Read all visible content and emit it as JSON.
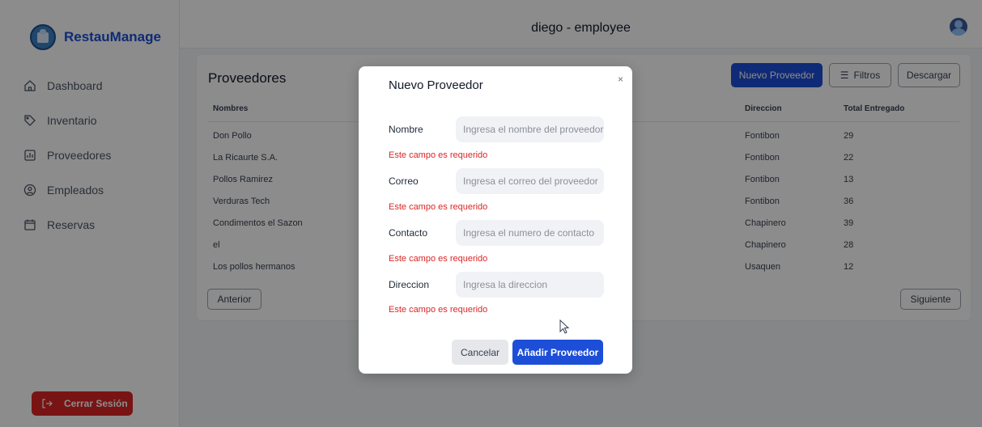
{
  "sidebar": {
    "brand": "RestauManage",
    "items": [
      {
        "label": "Dashboard",
        "icon": "home-icon"
      },
      {
        "label": "Inventario",
        "icon": "tag-icon"
      },
      {
        "label": "Proveedores",
        "icon": "chart-icon"
      },
      {
        "label": "Empleados",
        "icon": "user-circle-icon"
      },
      {
        "label": "Reservas",
        "icon": "calendar-icon"
      }
    ],
    "logout": "Cerrar Sesión"
  },
  "header": {
    "title": "diego - employee"
  },
  "main": {
    "title": "Proveedores",
    "buttons": {
      "new": "Nuevo Proveedor",
      "filter": "Filtros",
      "download": "Descargar"
    },
    "columns": [
      "Nombres",
      "Direccion",
      "Total Entregado"
    ],
    "rows": [
      {
        "name": "Don Pollo",
        "address": "Fontibon",
        "total": "29"
      },
      {
        "name": "La Ricaurte S.A.",
        "address": "Fontibon",
        "total": "22"
      },
      {
        "name": "Pollos Ramirez",
        "address": "Fontibon",
        "total": "13"
      },
      {
        "name": "Verduras Tech",
        "address": "Fontibon",
        "total": "36"
      },
      {
        "name": "Condimentos el Sazon",
        "address": "Chapinero",
        "total": "39"
      },
      {
        "name": "el",
        "address": "Chapinero",
        "total": "28"
      },
      {
        "name": "Los pollos hermanos",
        "address": "Usaquen",
        "total": "12"
      }
    ],
    "pagination": {
      "prev": "Anterior",
      "next": "Siguiente"
    }
  },
  "modal": {
    "title": "Nuevo Proveedor",
    "close": "×",
    "fields": [
      {
        "label": "Nombre",
        "placeholder": "Ingresa el nombre del proveedor",
        "error": "Este campo es requerido"
      },
      {
        "label": "Correo",
        "placeholder": "Ingresa el correo del proveedor",
        "error": "Este campo es requerido"
      },
      {
        "label": "Contacto",
        "placeholder": "Ingresa el numero de contacto",
        "error": "Este campo es requerido"
      },
      {
        "label": "Direccion",
        "placeholder": "Ingresa la direccion",
        "error": "Este campo es requerido"
      }
    ],
    "cancel": "Cancelar",
    "submit": "Añadir Proveedor"
  },
  "colors": {
    "primary": "#1d4ed8",
    "danger": "#dc2626",
    "error_text": "#dc2626"
  }
}
